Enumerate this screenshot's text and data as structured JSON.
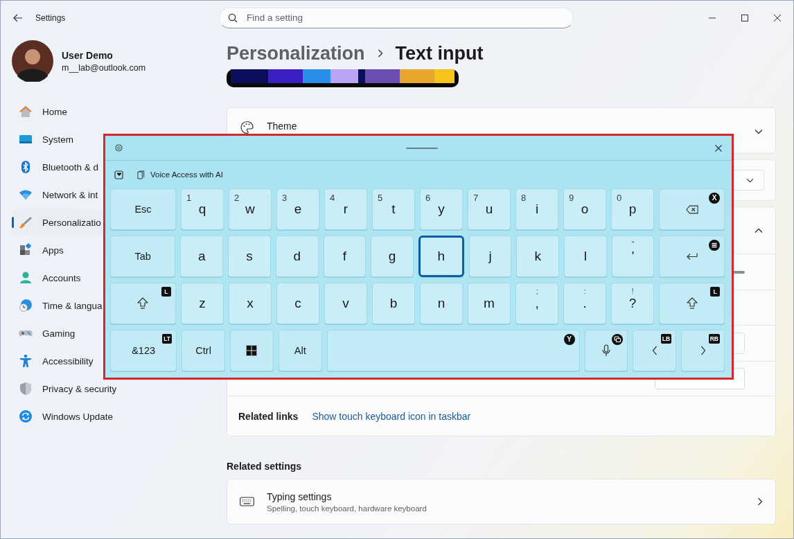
{
  "window": {
    "title": "Settings"
  },
  "search": {
    "placeholder": "Find a setting"
  },
  "profile": {
    "name": "User Demo",
    "email": "m__lab@outlook.com"
  },
  "nav": [
    {
      "label": "Home",
      "selected": false
    },
    {
      "label": "System",
      "selected": false
    },
    {
      "label": "Bluetooth & d",
      "selected": false
    },
    {
      "label": "Network & int",
      "selected": false
    },
    {
      "label": "Personalizatio",
      "selected": true
    },
    {
      "label": "Apps",
      "selected": false
    },
    {
      "label": "Accounts",
      "selected": false
    },
    {
      "label": "Time & langua",
      "selected": false
    },
    {
      "label": "Gaming",
      "selected": false
    },
    {
      "label": "Accessibility",
      "selected": false
    },
    {
      "label": "Privacy & security",
      "selected": false
    },
    {
      "label": "Windows Update",
      "selected": false
    }
  ],
  "breadcrumb": {
    "parent": "Personalization",
    "current": "Text input"
  },
  "theme_card": {
    "label": "Theme",
    "expanded": false
  },
  "keyboard_section": {
    "expanded": true
  },
  "related_links": {
    "label": "Related links",
    "link": "Show touch keyboard icon in taskbar"
  },
  "related_settings": {
    "heading": "Related settings",
    "items": [
      {
        "title": "Typing settings",
        "subtitle": "Spelling, touch keyboard, hardware keyboard"
      }
    ]
  },
  "touch_keyboard": {
    "suggestion": "Voice Access with AI",
    "rows": [
      [
        {
          "kind": "wide",
          "label": "Esc",
          "focused": false
        },
        {
          "kind": "letter",
          "label": "q",
          "hint": "1",
          "focused": false
        },
        {
          "kind": "letter",
          "label": "w",
          "hint": "2",
          "focused": false
        },
        {
          "kind": "letter",
          "label": "e",
          "hint": "3",
          "focused": false
        },
        {
          "kind": "letter",
          "label": "r",
          "hint": "4",
          "focused": false
        },
        {
          "kind": "letter",
          "label": "t",
          "hint": "5",
          "focused": false
        },
        {
          "kind": "letter",
          "label": "y",
          "hint": "6",
          "focused": false
        },
        {
          "kind": "letter",
          "label": "u",
          "hint": "7",
          "focused": false
        },
        {
          "kind": "letter",
          "label": "i",
          "hint": "8",
          "focused": false
        },
        {
          "kind": "letter",
          "label": "o",
          "hint": "9",
          "focused": false
        },
        {
          "kind": "letter",
          "label": "p",
          "hint": "0",
          "focused": false
        },
        {
          "kind": "backspace",
          "focused": false,
          "badge": "X"
        }
      ],
      [
        {
          "kind": "wide",
          "label": "Tab",
          "focused": false
        },
        {
          "kind": "letter",
          "label": "a",
          "focused": false
        },
        {
          "kind": "letter",
          "label": "s",
          "focused": false
        },
        {
          "kind": "letter",
          "label": "d",
          "focused": false
        },
        {
          "kind": "letter",
          "label": "f",
          "focused": false
        },
        {
          "kind": "letter",
          "label": "g",
          "focused": false
        },
        {
          "kind": "letter",
          "label": "h",
          "focused": true
        },
        {
          "kind": "letter",
          "label": "j",
          "focused": false
        },
        {
          "kind": "letter",
          "label": "k",
          "focused": false
        },
        {
          "kind": "letter",
          "label": "l",
          "focused": false
        },
        {
          "kind": "symbol",
          "label": "'",
          "hint": "\"",
          "focused": false
        },
        {
          "kind": "enter",
          "focused": false
        }
      ],
      [
        {
          "kind": "shift",
          "focused": false,
          "badge": "L"
        },
        {
          "kind": "letter",
          "label": "z",
          "focused": false
        },
        {
          "kind": "letter",
          "label": "x",
          "focused": false
        },
        {
          "kind": "letter",
          "label": "c",
          "focused": false
        },
        {
          "kind": "letter",
          "label": "v",
          "focused": false
        },
        {
          "kind": "letter",
          "label": "b",
          "focused": false
        },
        {
          "kind": "letter",
          "label": "n",
          "focused": false
        },
        {
          "kind": "letter",
          "label": "m",
          "focused": false
        },
        {
          "kind": "symbol",
          "label": ",",
          "hint": ";",
          "focused": false
        },
        {
          "kind": "symbol",
          "label": ".",
          "hint": ":",
          "focused": false
        },
        {
          "kind": "symbol",
          "label": "?",
          "hint": "!",
          "focused": false
        },
        {
          "kind": "shift",
          "focused": false,
          "badge": "L"
        }
      ]
    ],
    "bottom_row": [
      {
        "kind": "wide",
        "label": "&123",
        "focused": false,
        "badge": "LT"
      },
      {
        "kind": "modifier",
        "label": "Ctrl",
        "focused": false
      },
      {
        "kind": "windows",
        "focused": false
      },
      {
        "kind": "modifier",
        "label": "Alt",
        "focused": false
      },
      {
        "kind": "space",
        "focused": false,
        "badge": "Y"
      },
      {
        "kind": "mic",
        "focused": false
      },
      {
        "kind": "left",
        "focused": false,
        "badge": "LB"
      },
      {
        "kind": "right",
        "focused": false,
        "badge": "RB"
      }
    ]
  }
}
